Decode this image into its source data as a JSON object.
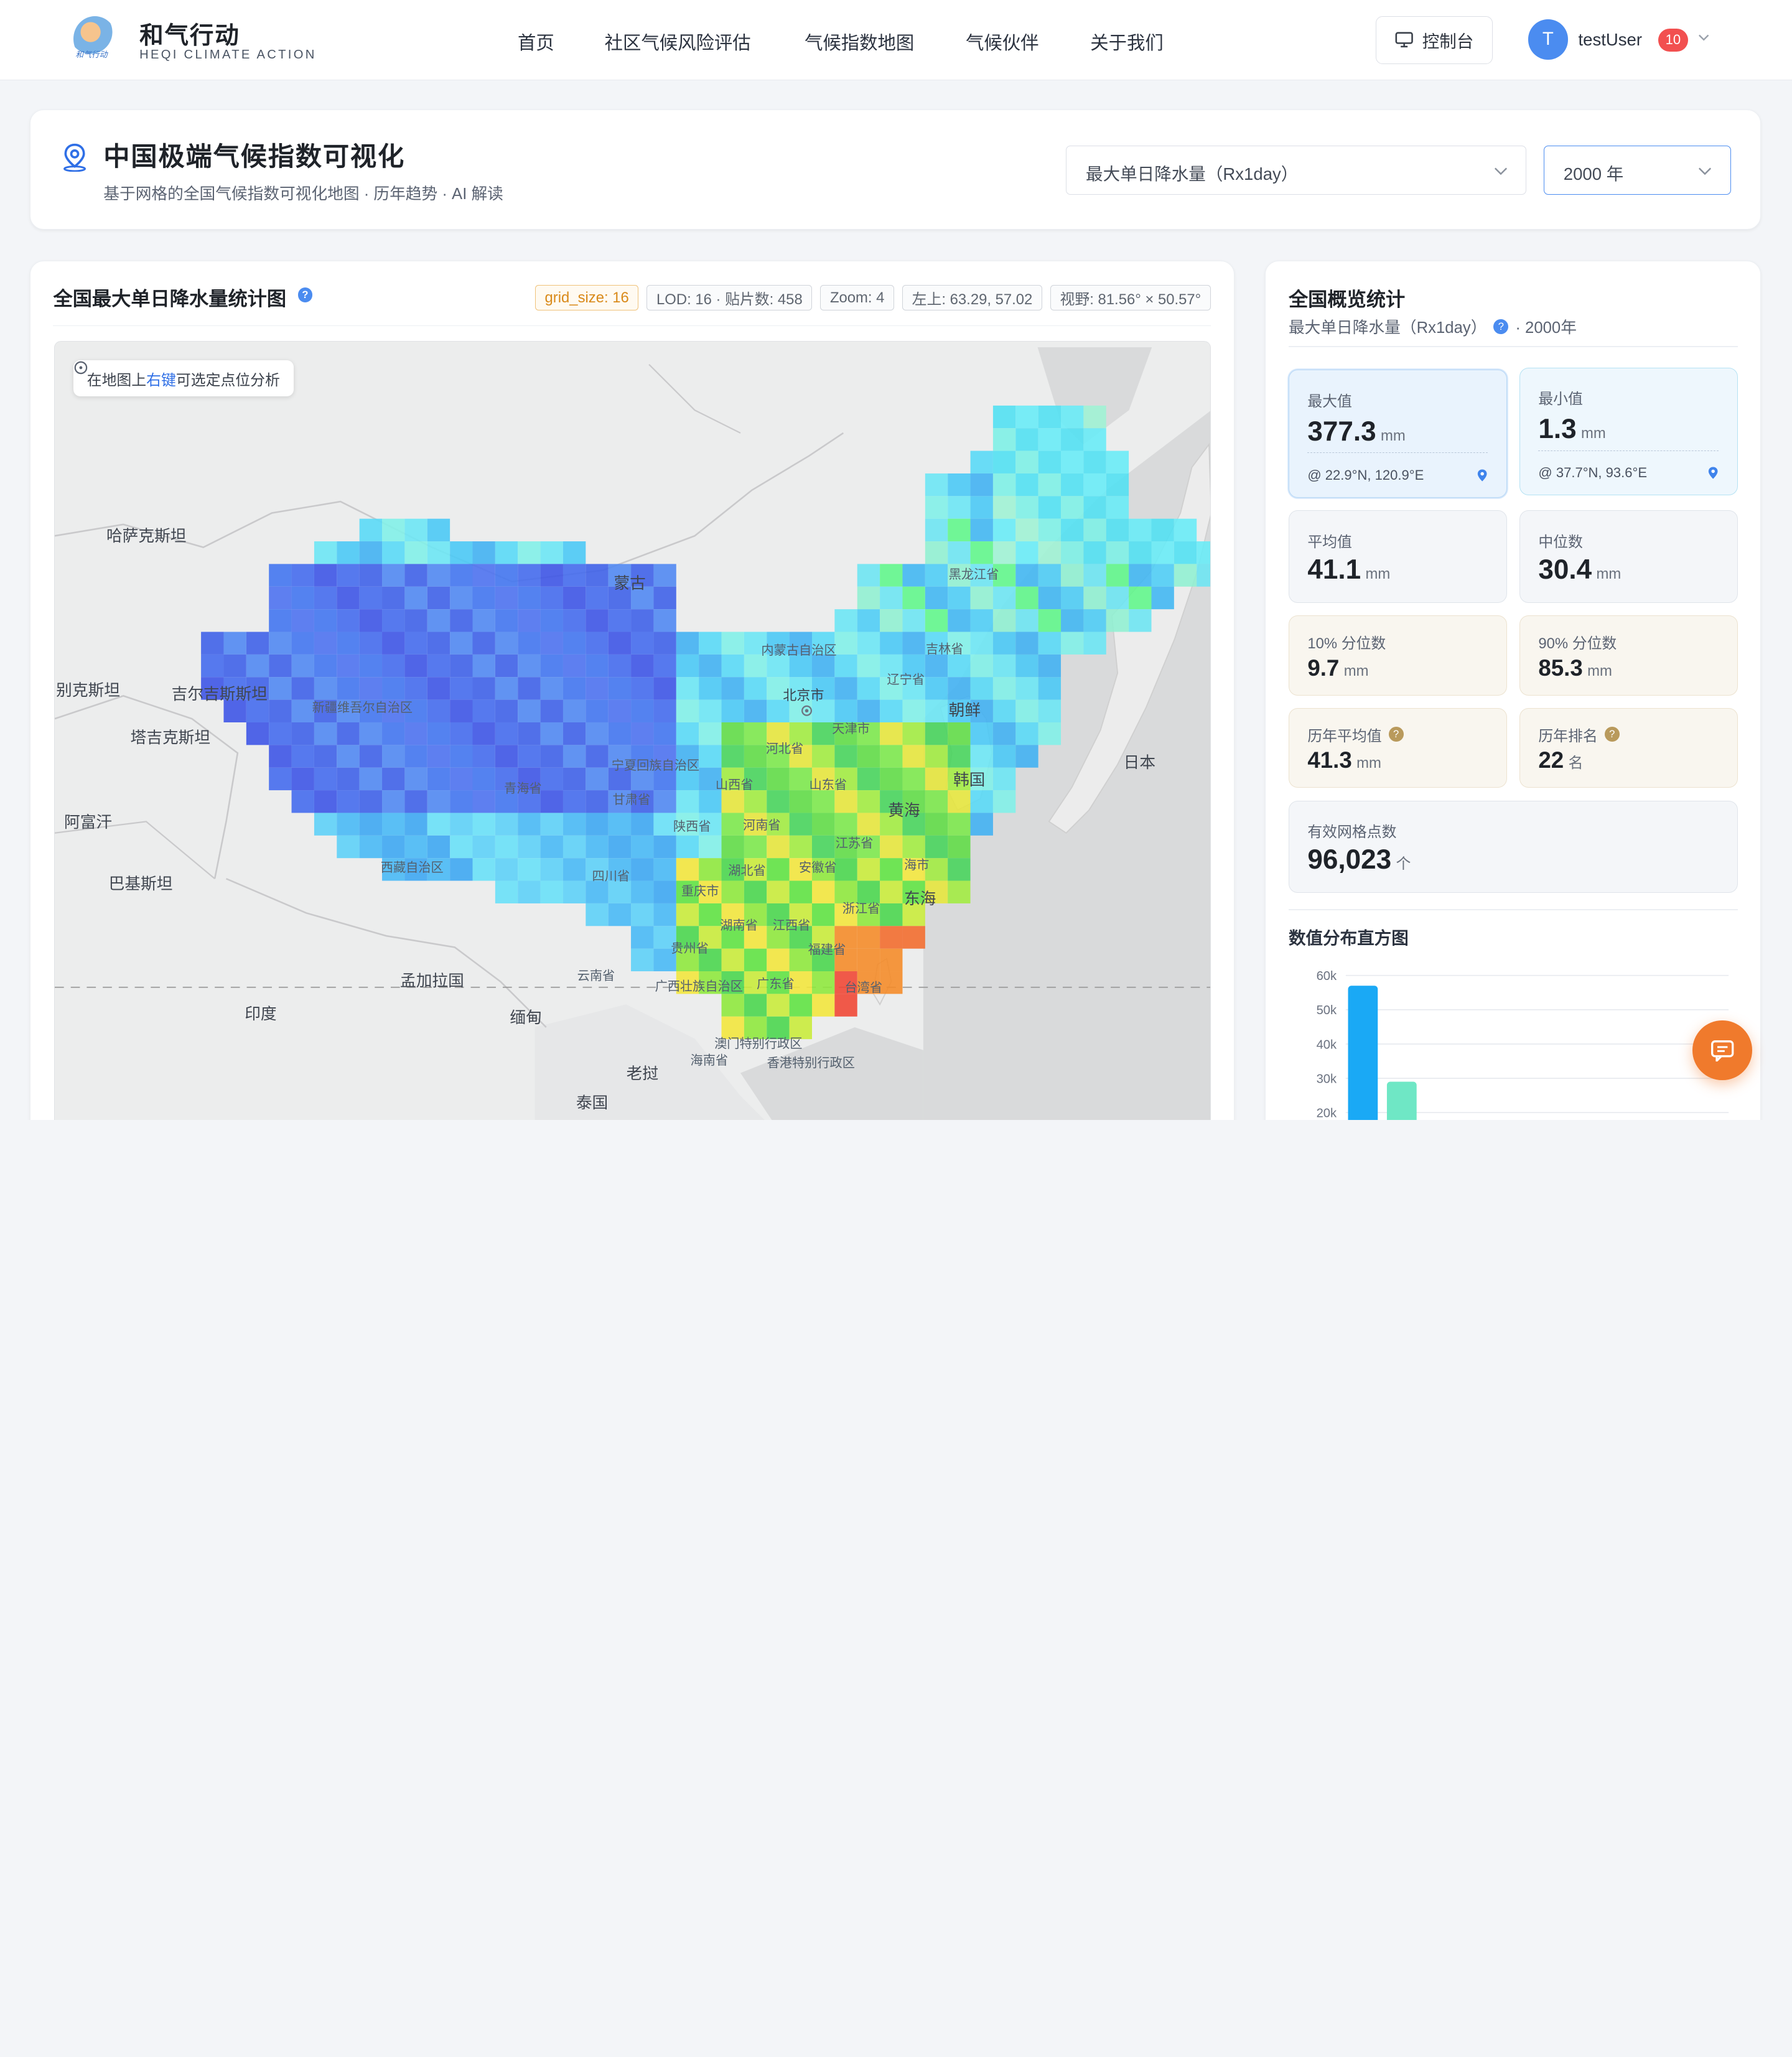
{
  "nav": {
    "logo_ink": "和气行动",
    "brand_title": "和气行动",
    "brand_sub": "HEQI CLIMATE ACTION",
    "links": [
      "首页",
      "社区气候风险评估",
      "气候指数地图",
      "气候伙伴",
      "关于我们"
    ],
    "console_label": "控制台",
    "avatar_letter": "T",
    "username": "testUser",
    "notification_count": "10"
  },
  "header": {
    "title": "中国极端气候指数可视化",
    "subtitle": "基于网格的全国气候指数可视化地图 · 历年趋势 · AI 解读",
    "index_select": "最大单日降水量（Rx1day）",
    "year_select": "2000 年"
  },
  "map_panel": {
    "title": "全国最大单日降水量统计图",
    "tags": {
      "grid": "grid_size: 16",
      "lod": "LOD: 16 · 贴片数: 458",
      "zoom": "Zoom: 4",
      "topleft": "左上: 63.29, 57.02",
      "view": "视野: 81.56° × 50.57°"
    },
    "hint_pre": "在地图上",
    "hint_key": "右键",
    "hint_post": "可选定点位分析",
    "labels": {
      "kazakhstan": "哈萨克斯坦",
      "mongolia": "蒙古",
      "uzbek": "别克斯坦",
      "kyrgyz": "吉尔吉斯斯坦",
      "tajik": "塔吉克斯坦",
      "afghan": "阿富汗",
      "pakistan": "巴基斯坦",
      "india": "印度",
      "bangladesh": "孟加拉国",
      "myanmar": "缅甸",
      "laos": "老挝",
      "thailand": "泰国",
      "korea_n": "朝鲜",
      "korea_s": "韩国",
      "japan": "日本",
      "yellow_sea": "黄海",
      "east_sea": "东海",
      "xinjiang": "新疆维吾尔自治区",
      "tibet": "西藏自治区",
      "qinghai": "青海省",
      "gansu": "甘肃省",
      "ningxia": "宁夏回族自治区",
      "inner_mongolia": "内蒙古自治区",
      "heilongjiang": "黑龙江省",
      "jilin": "吉林省",
      "liaoning": "辽宁省",
      "beijing": "北京市",
      "tianjin": "天津市",
      "hebei": "河北省",
      "shanxi": "山西省",
      "shandong": "山东省",
      "henan": "河南省",
      "shaanxi": "陕西省",
      "jiangsu": "江苏省",
      "anhui": "安徽省",
      "shanghai": "海市",
      "hubei": "湖北省",
      "sichuan": "四川省",
      "chongqing": "重庆市",
      "zhejiang": "浙江省",
      "hunan": "湖南省",
      "jiangxi": "江西省",
      "guizhou": "贵州省",
      "fujian": "福建省",
      "yunnan": "云南省",
      "guangxi": "广西壮族自治区",
      "guangdong": "广东省",
      "taiwan": "台湾省",
      "macau": "澳门特别行政区",
      "hongkong": "香港特别行政区",
      "hainan": "海南省"
    }
  },
  "stats": {
    "title": "全国概览统计",
    "subtitle_pre": "最大单日降水量（Rx1day）",
    "subtitle_post": "· 2000年",
    "max": {
      "label": "最大值",
      "value": "377.3",
      "unit": "mm",
      "location": "@ 22.9°N, 120.9°E"
    },
    "min": {
      "label": "最小值",
      "value": "1.3",
      "unit": "mm",
      "location": "@ 37.7°N, 93.6°E"
    },
    "mean": {
      "label": "平均值",
      "value": "41.1",
      "unit": "mm"
    },
    "median": {
      "label": "中位数",
      "value": "30.4",
      "unit": "mm"
    },
    "p10": {
      "label": "10% 分位数",
      "value": "9.7",
      "unit": "mm"
    },
    "p90": {
      "label": "90% 分位数",
      "value": "85.3",
      "unit": "mm"
    },
    "hist_mean": {
      "label": "历年平均值",
      "value": "41.3",
      "unit": "mm"
    },
    "rank": {
      "label": "历年排名",
      "value": "22",
      "unit": "名"
    },
    "valid": {
      "label": "有效网格点数",
      "value": "96,023",
      "unit": "个"
    },
    "hist_title": "数值分布直方图"
  },
  "chart_data": {
    "type": "bar",
    "title": "数值分布直方图",
    "y_ticks": [
      "60k",
      "50k",
      "40k",
      "30k",
      "20k"
    ],
    "ylim": [
      20000,
      60000
    ],
    "values": [
      57000,
      29000
    ],
    "colors": [
      "#1aa9f5",
      "#6fe7c5"
    ],
    "grid": true
  }
}
